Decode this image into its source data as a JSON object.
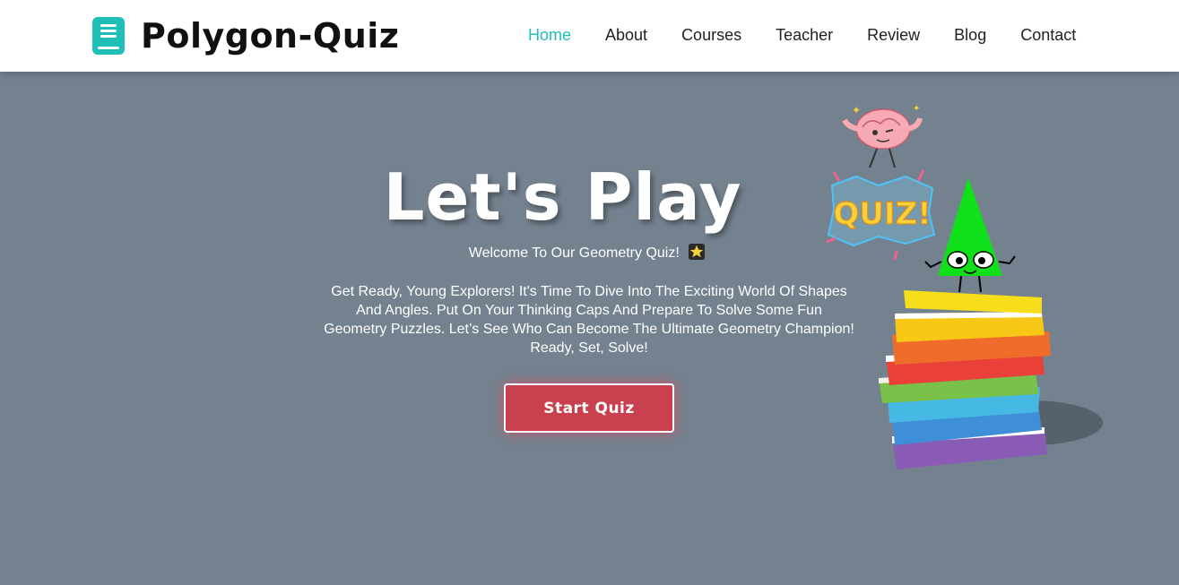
{
  "brand": {
    "name": "Polygon-Quiz",
    "icon": "book-icon"
  },
  "nav": {
    "items": [
      {
        "label": "Home",
        "active": true
      },
      {
        "label": "About",
        "active": false
      },
      {
        "label": "Courses",
        "active": false
      },
      {
        "label": "Teacher",
        "active": false
      },
      {
        "label": "Review",
        "active": false
      },
      {
        "label": "Blog",
        "active": false
      },
      {
        "label": "Contact",
        "active": false
      }
    ]
  },
  "hero": {
    "title": "Let's Play",
    "subtitle": "Welcome To Our Geometry Quiz!",
    "subtitle_icon": "star-icon",
    "paragraph": "Get Ready, Young Explorers! It's Time To Dive Into The Exciting World Of Shapes And Angles. Put On Your Thinking Caps And Prepare To Solve Some Fun Geometry Puzzles. Let’s See Who Can Become The Ultimate Geometry Champion! Ready, Set, Solve!",
    "button": "Start Quiz",
    "sticker_text": "QUIZ!"
  },
  "colors": {
    "accent": "#1ebfb6",
    "button": "#c9404f",
    "hero_bg": "#74828f"
  }
}
